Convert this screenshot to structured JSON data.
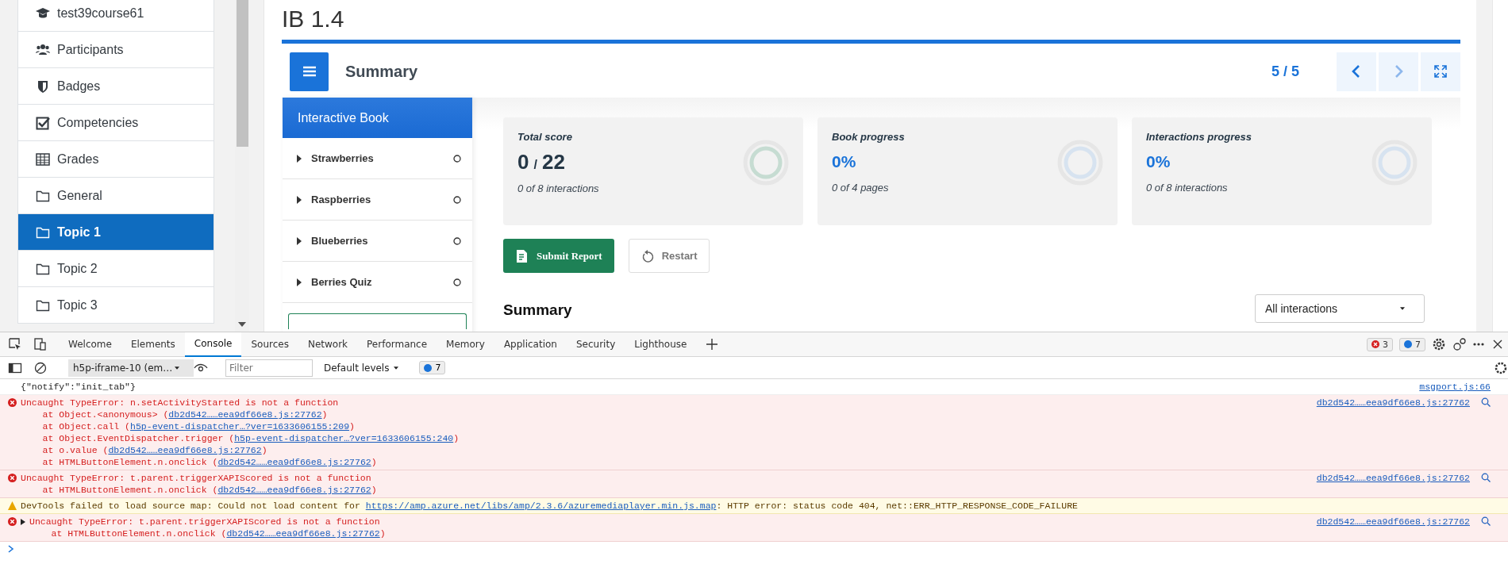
{
  "sidebar": {
    "items": [
      {
        "kind": "course",
        "label": "test39course61",
        "selected": false
      },
      {
        "kind": "participants",
        "label": "Participants",
        "selected": false
      },
      {
        "kind": "badges",
        "label": "Badges",
        "selected": false
      },
      {
        "kind": "competencies",
        "label": "Competencies",
        "selected": false
      },
      {
        "kind": "grades",
        "label": "Grades",
        "selected": false
      },
      {
        "kind": "section",
        "label": "General",
        "selected": false
      },
      {
        "kind": "section",
        "label": "Topic 1",
        "selected": true
      },
      {
        "kind": "section",
        "label": "Topic 2",
        "selected": false
      },
      {
        "kind": "section",
        "label": "Topic 3",
        "selected": false
      }
    ]
  },
  "page": {
    "title": "IB 1.4"
  },
  "book": {
    "header_title": "Summary",
    "page_counter": "5 / 5",
    "nav_title": "Interactive Book",
    "chapters": [
      {
        "title": "Strawberries"
      },
      {
        "title": "Raspberries"
      },
      {
        "title": "Blueberries"
      },
      {
        "title": "Berries Quiz"
      }
    ],
    "cards": [
      {
        "kind": "score",
        "title": "Total score",
        "score": "0",
        "separator": "/",
        "total": "22",
        "caption": "0 of 8 interactions"
      },
      {
        "kind": "percent",
        "title": "Book progress",
        "value": "0%",
        "caption": "0 of 4 pages"
      },
      {
        "kind": "percent",
        "title": "Interactions progress",
        "value": "0%",
        "caption": "0 of 8 interactions"
      }
    ],
    "submit_label": "Submit Report",
    "restart_label": "Restart",
    "summary_heading": "Summary",
    "filter_value": "All interactions"
  },
  "devtools": {
    "tabs": [
      {
        "label": "Welcome",
        "selected": false
      },
      {
        "label": "Elements",
        "selected": false
      },
      {
        "label": "Console",
        "selected": true
      },
      {
        "label": "Sources",
        "selected": false
      },
      {
        "label": "Network",
        "selected": false
      },
      {
        "label": "Performance",
        "selected": false
      },
      {
        "label": "Memory",
        "selected": false
      },
      {
        "label": "Application",
        "selected": false
      },
      {
        "label": "Security",
        "selected": false
      },
      {
        "label": "Lighthouse",
        "selected": false
      }
    ],
    "error_count": "3",
    "message_count": "7",
    "context": "h5p-iframe-10 (em…",
    "filter_placeholder": "Filter",
    "levels": "Default levels",
    "levels_badge": "7",
    "messages": [
      {
        "kind": "log",
        "expandable": false,
        "lines": [
          [
            {
              "t": "{\"notify\":\"init_tab\"}"
            }
          ]
        ],
        "source": "msgport.js:66"
      },
      {
        "kind": "error",
        "expandable": false,
        "lines": [
          [
            {
              "t": "Uncaught TypeError: n.setActivityStarted is not a function"
            }
          ],
          [
            {
              "t": "    at Object.<anonymous> ("
            },
            {
              "link": "db2d542……eea9df66e8.js:27762"
            },
            {
              "t": ")"
            }
          ],
          [
            {
              "t": "    at Object.call ("
            },
            {
              "link": "h5p-event-dispatcher…?ver=1633606155:209"
            },
            {
              "t": ")"
            }
          ],
          [
            {
              "t": "    at Object.EventDispatcher.trigger ("
            },
            {
              "link": "h5p-event-dispatcher…?ver=1633606155:240"
            },
            {
              "t": ")"
            }
          ],
          [
            {
              "t": "    at o.value ("
            },
            {
              "link": "db2d542……eea9df66e8.js:27762"
            },
            {
              "t": ")"
            }
          ],
          [
            {
              "t": "    at HTMLButtonElement.n.onclick ("
            },
            {
              "link": "db2d542……eea9df66e8.js:27762"
            },
            {
              "t": ")"
            }
          ]
        ],
        "source": "db2d542……eea9df66e8.js:27762"
      },
      {
        "kind": "error",
        "expandable": false,
        "lines": [
          [
            {
              "t": "Uncaught TypeError: t.parent.triggerXAPIScored is not a function"
            }
          ],
          [
            {
              "t": "    at HTMLButtonElement.n.onclick ("
            },
            {
              "link": "db2d542……eea9df66e8.js:27762"
            },
            {
              "t": ")"
            }
          ]
        ],
        "source": "db2d542……eea9df66e8.js:27762"
      },
      {
        "kind": "warning",
        "expandable": false,
        "lines": [
          [
            {
              "t": "DevTools failed to load source map: Could not load content for "
            },
            {
              "link": "https://amp.azure.net/libs/amp/2.3.6/azuremediaplayer.min.js.map"
            },
            {
              "t": ": HTTP error: status code 404, net::ERR_HTTP_RESPONSE_CODE_FAILURE"
            }
          ]
        ]
      },
      {
        "kind": "error",
        "expandable": true,
        "lines": [
          [
            {
              "t": "Uncaught TypeError: t.parent.triggerXAPIScored is not a function"
            }
          ],
          [
            {
              "t": "    at HTMLButtonElement.n.onclick ("
            },
            {
              "link": "db2d542……eea9df66e8.js:27762"
            },
            {
              "t": ")"
            }
          ]
        ],
        "source": "db2d542……eea9df66e8.js:27762"
      }
    ]
  }
}
